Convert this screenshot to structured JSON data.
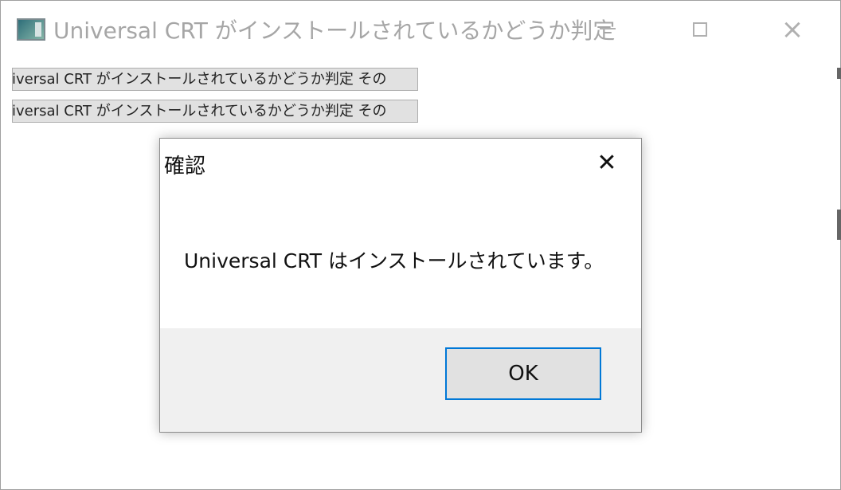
{
  "window": {
    "title": "Universal CRT がインストールされているかどうか判定",
    "icons": [
      "app-icon",
      "minimize-icon",
      "maximize-icon",
      "close-icon"
    ]
  },
  "main": {
    "buttons": [
      {
        "label": "iiversal CRT がインストールされているかどうか判定 その"
      },
      {
        "label": "iiversal CRT がインストールされているかどうか判定 その"
      }
    ]
  },
  "dialog": {
    "title": "確認",
    "message": "Universal CRT はインストールされています。",
    "ok_label": "OK",
    "close_glyph": "✕",
    "accent": "#0078d7"
  }
}
